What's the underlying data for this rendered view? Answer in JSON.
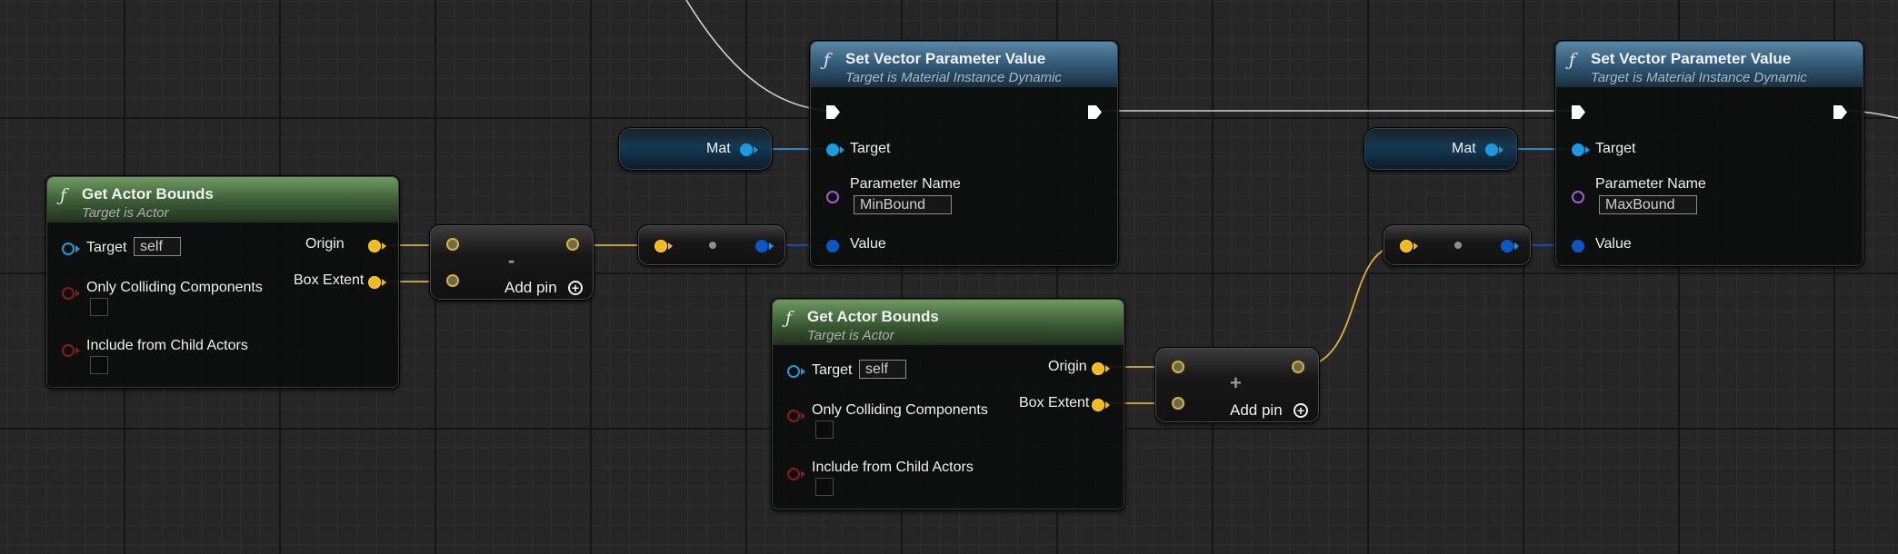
{
  "colors": {
    "vector_wire": "#e0b030",
    "object_wire": "#1a9adf",
    "exec_wire": "#d0d0d0",
    "pure_header": "#4f7a47",
    "impure_header": "#3c6688"
  },
  "get_actor_bounds_1": {
    "icon": "function-icon",
    "title": "Get Actor Bounds",
    "subtitle": "Target is Actor",
    "target_label": "Target",
    "target_value": "self",
    "only_colliding_label": "Only Colliding Components",
    "include_child_label": "Include from Child Actors",
    "origin_label": "Origin",
    "box_extent_label": "Box Extent"
  },
  "get_actor_bounds_2": {
    "icon": "function-icon",
    "title": "Get Actor Bounds",
    "subtitle": "Target is Actor",
    "target_label": "Target",
    "target_value": "self",
    "only_colliding_label": "Only Colliding Components",
    "include_child_label": "Include from Child Actors",
    "origin_label": "Origin",
    "box_extent_label": "Box Extent"
  },
  "subtract_node": {
    "operator": "-",
    "add_pin_label": "Add pin"
  },
  "add_node": {
    "operator": "+",
    "add_pin_label": "Add pin"
  },
  "mat_var_1": {
    "label": "Mat"
  },
  "mat_var_2": {
    "label": "Mat"
  },
  "set_vector_1": {
    "icon": "function-icon",
    "title": "Set Vector Parameter Value",
    "subtitle": "Target is Material Instance Dynamic",
    "target_label": "Target",
    "param_name_label": "Parameter Name",
    "param_name_value": "MinBound",
    "value_label": "Value"
  },
  "set_vector_2": {
    "icon": "function-icon",
    "title": "Set Vector Parameter Value",
    "subtitle": "Target is Material Instance Dynamic",
    "target_label": "Target",
    "param_name_label": "Parameter Name",
    "param_name_value": "MaxBound",
    "value_label": "Value"
  }
}
